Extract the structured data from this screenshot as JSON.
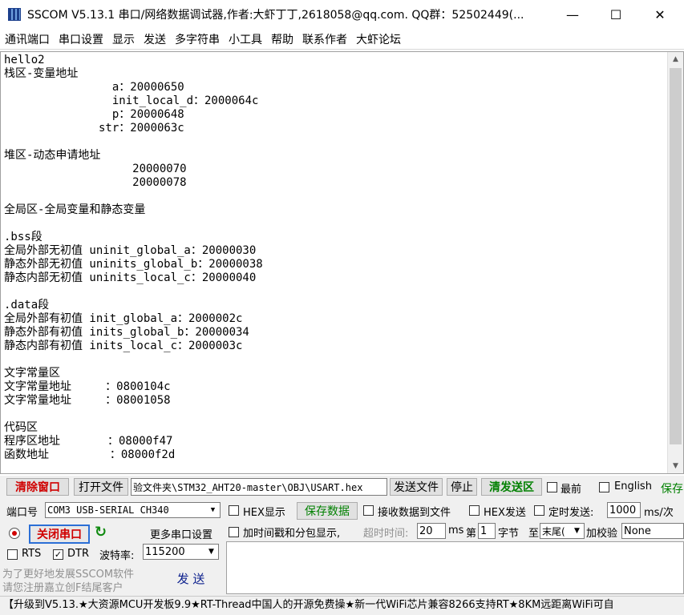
{
  "window": {
    "title": "SSCOM V5.13.1 串口/网络数据调试器,作者:大虾丁丁,2618058@qq.com. QQ群：52502449(...",
    "minimize_glyph": "—",
    "maximize_glyph": "☐",
    "close_glyph": "✕"
  },
  "menu": [
    "通讯端口",
    "串口设置",
    "显示",
    "发送",
    "多字符串",
    "小工具",
    "帮助",
    "联系作者",
    "大虾论坛"
  ],
  "receive_text": "hello2\n栈区-变量地址\n                a：20000650\n                init_local_d：2000064c\n                p：20000648\n              str：2000063c\n\n堆区-动态申请地址\n                   20000070\n                   20000078\n\n全局区-全局变量和静态变量\n\n.bss段\n全局外部无初值 uninit_global_a：20000030\n静态外部无初值 uninits_global_b：20000038\n静态内部无初值 uninits_local_c：20000040\n\n.data段\n全局外部有初值 init_global_a：2000002c\n静态外部有初值 inits_global_b：20000034\n静态内部有初值 inits_local_c：2000003c\n\n文字常量区\n文字常量地址     ：0800104c\n文字常量地址     ：08001058\n\n代码区\n程序区地址       ：08000f47\n函数地址         ：08000f2d",
  "row1": {
    "clear_window": "清除窗口",
    "open_file": "打开文件",
    "file_path": "验文件夹\\STM32_AHT20-master\\OBJ\\USART.hex",
    "send_file": "发送文件",
    "stop": "停止",
    "clear_send": "清发送区",
    "topmost": "最前",
    "english": "English",
    "save": "保存"
  },
  "row2": {
    "port_label": "端口号",
    "port_value": "COM3 USB-SERIAL CH340",
    "hex_display": "HEX显示",
    "save_data": "保存数据",
    "recv_to_file": "接收数据到文件",
    "hex_send": "HEX发送",
    "timed_send": "定时发送:",
    "interval": "1000",
    "interval_unit": "ms/次"
  },
  "row3": {
    "close_port": "关闭串口",
    "refresh_glyph": "↻",
    "more_settings": "更多串口设置",
    "timestamp": "加时间戳和分包显示,",
    "timeout_label": "超时时间:",
    "timeout_value": "20",
    "ms": "ms",
    "nth": "第",
    "byte_index": "1",
    "byte": "字节",
    "to": "至",
    "tail": "末尾(",
    "checksum_label": "加校验",
    "checksum_value": "None"
  },
  "row4": {
    "rts": "RTS",
    "dtr": "DTR",
    "baud_label": "波特率:",
    "baud_value": "115200"
  },
  "promo": {
    "line1": "为了更好地发展SSCOM软件",
    "line2": "请您注册嘉立创F结尾客户",
    "send": "发  送"
  },
  "status_text": "【升级到V5.13.★大资源MCU开发板9.9★RT-Thread中国人的开源免费操★新一代WiFi芯片兼容8266支持RT★8KM远距离WiFi可自",
  "colors": {
    "red": "#d00000",
    "green": "#008000"
  }
}
